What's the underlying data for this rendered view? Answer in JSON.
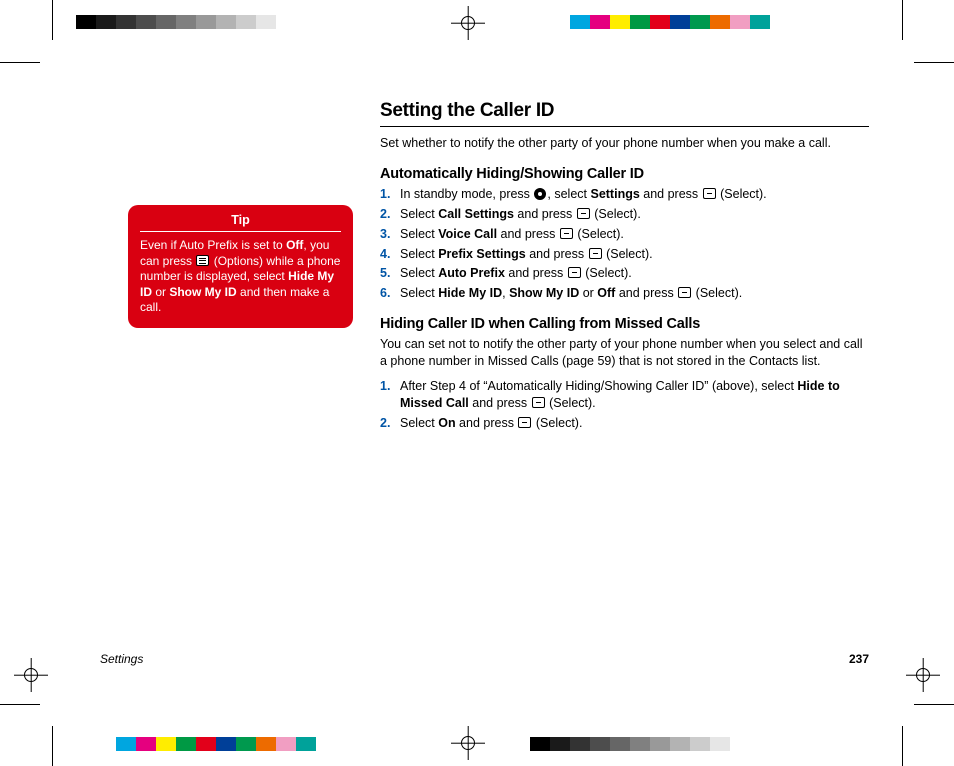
{
  "header": {
    "title": "Setting the Caller ID",
    "intro": "Set whether to notify the other party of your phone number when you make a call."
  },
  "section1": {
    "heading": "Automatically Hiding/Showing Caller ID",
    "steps": [
      {
        "num": "1.",
        "pre": "In standby mode, press ",
        "icon1": "dot",
        "mid1": ", select ",
        "b1": "Settings",
        "mid2": " and press ",
        "icon2": "dash",
        "tail": " (Select)."
      },
      {
        "num": "2.",
        "pre": "Select ",
        "b1": "Call Settings",
        "mid2": " and press ",
        "icon2": "dash",
        "tail": " (Select)."
      },
      {
        "num": "3.",
        "pre": "Select ",
        "b1": "Voice Call",
        "mid2": " and press ",
        "icon2": "dash",
        "tail": " (Select)."
      },
      {
        "num": "4.",
        "pre": "Select ",
        "b1": "Prefix Settings",
        "mid2": " and press ",
        "icon2": "dash",
        "tail": " (Select)."
      },
      {
        "num": "5.",
        "pre": "Select ",
        "b1": "Auto Prefix",
        "mid2": " and press ",
        "icon2": "dash",
        "tail": " (Select)."
      },
      {
        "num": "6.",
        "pre": "Select ",
        "b1": "Hide My ID",
        "sep1": ", ",
        "b2": "Show My ID",
        "sep2": " or ",
        "b3": "Off",
        "mid2": " and press ",
        "icon2": "dash",
        "tail": " (Select)."
      }
    ]
  },
  "section2": {
    "heading": "Hiding Caller ID when Calling from Missed Calls",
    "intro": "You can set not to notify the other party of your phone number when you select and call a phone number in Missed Calls (page 59) that is not stored in the Contacts list.",
    "steps": [
      {
        "num": "1.",
        "pre": "After Step 4 of “Automatically Hiding/Showing Caller ID” (above), select ",
        "b1": "Hide to Missed Call",
        "mid2": " and press ",
        "icon2": "dash",
        "tail": " (Select)."
      },
      {
        "num": "2.",
        "pre": "Select ",
        "b1": "On",
        "mid2": " and press ",
        "icon2": "dash",
        "tail": " (Select)."
      }
    ]
  },
  "tip": {
    "label": "Tip",
    "t1": "Even if Auto Prefix is set to ",
    "b1": "Off",
    "t2": ", you can press ",
    "t3": " (Options) while a phone number is displayed, select ",
    "b2": "Hide My ID",
    "t4": " or ",
    "b3": "Show My ID",
    "t5": " and then make a call."
  },
  "footer": {
    "section": "Settings",
    "page": "237"
  },
  "reg_colors_gray": [
    "#000000",
    "#1a1a1a",
    "#333333",
    "#4d4d4d",
    "#666666",
    "#808080",
    "#999999",
    "#b3b3b3",
    "#cccccc",
    "#e6e6e6",
    "#ffffff",
    "#ffffff",
    "#ffffff",
    "#ffffff"
  ],
  "reg_colors_cmy": [
    "#ffffff",
    "#ffffff",
    "#00a6e0",
    "#e5007f",
    "#ffed00",
    "#009944",
    "#e2001a",
    "#003f98",
    "#00994e",
    "#ed6b00",
    "#f19ec2",
    "#00a29a",
    "#ffffff",
    "#ffffff"
  ]
}
